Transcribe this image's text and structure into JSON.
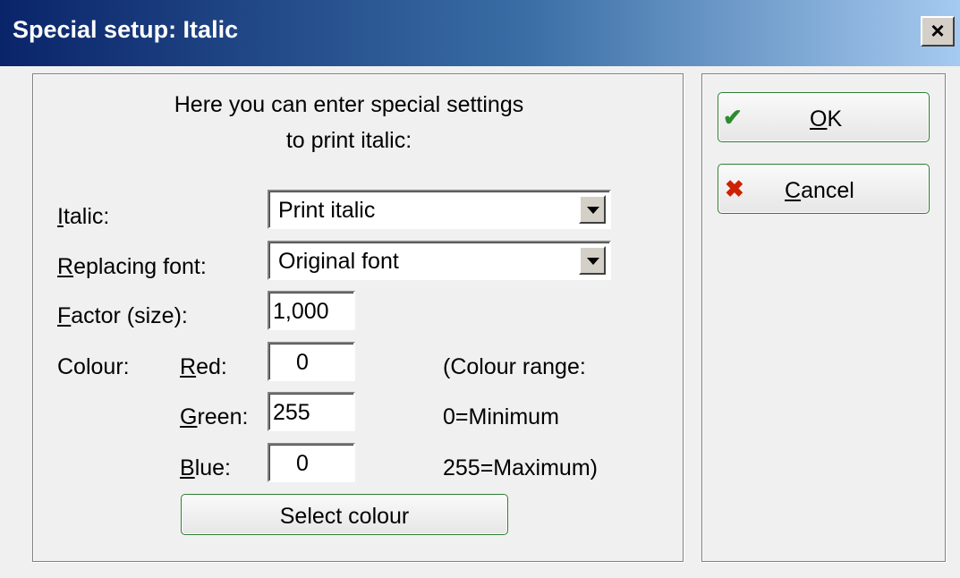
{
  "window": {
    "title": "Special setup: Italic",
    "close_glyph": "×"
  },
  "intro": {
    "line1": "Here you can enter special settings",
    "line2": "to print italic:"
  },
  "italic": {
    "label_u": "I",
    "label_rest": "talic:",
    "value": "Print italic"
  },
  "replacing_font": {
    "label_u": "R",
    "label_rest": "eplacing font:",
    "value": "Original font"
  },
  "factor": {
    "label_u": "F",
    "label_rest": "actor (size):",
    "value": "1,000"
  },
  "colour": {
    "label": "Colour:",
    "red": {
      "label_u": "R",
      "label_rest": "ed:",
      "value": "0"
    },
    "green": {
      "label_u": "G",
      "label_rest": "reen:",
      "value": "255"
    },
    "blue": {
      "label_u": "B",
      "label_rest": "lue:",
      "value": "0"
    },
    "range_line1": "(Colour range:",
    "range_line2": "0=Minimum",
    "range_line3": "255=Maximum)",
    "select_button": "Select colour"
  },
  "buttons": {
    "ok": {
      "label_u": "O",
      "label_rest": "K",
      "icon": "check-icon",
      "icon_color": "#2e8b2e"
    },
    "cancel": {
      "label_u": "C",
      "label_rest": "ancel",
      "icon": "x-icon",
      "icon_color": "#cc2200"
    }
  }
}
